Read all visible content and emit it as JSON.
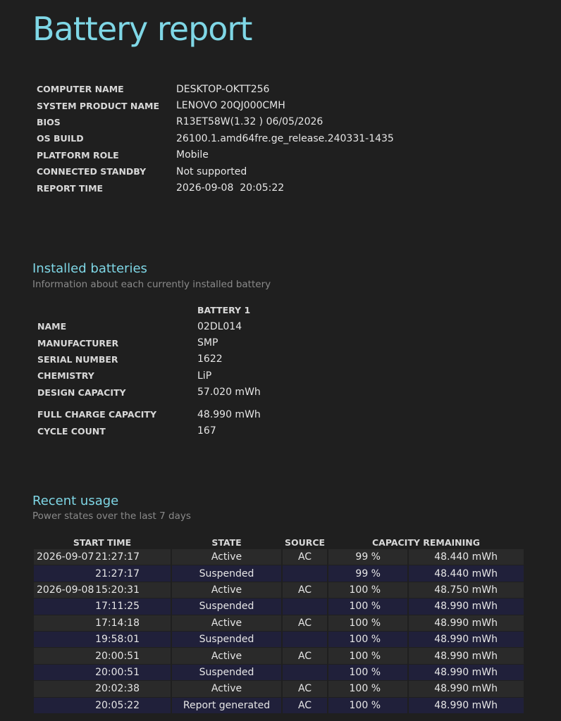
{
  "title": "Battery report",
  "system": [
    {
      "key": "COMPUTER NAME",
      "value": "DESKTOP-OKTT256"
    },
    {
      "key": "SYSTEM PRODUCT NAME",
      "value": "LENOVO 20QJ000CMH"
    },
    {
      "key": "BIOS",
      "value": "R13ET58W(1.32 ) 06/05/2026"
    },
    {
      "key": "OS BUILD",
      "value": "26100.1.amd64fre.ge_release.240331-1435"
    },
    {
      "key": "PLATFORM ROLE",
      "value": "Mobile"
    },
    {
      "key": "CONNECTED STANDBY",
      "value": "Not supported"
    },
    {
      "key": "REPORT TIME",
      "value": "2026-09-08  20:05:22"
    }
  ],
  "installed_batteries": {
    "title": "Installed batteries",
    "subtitle": "Information about each currently installed battery",
    "column_header": "BATTERY 1",
    "rows": [
      {
        "key": "NAME",
        "value": "02DL014"
      },
      {
        "key": "MANUFACTURER",
        "value": "SMP"
      },
      {
        "key": "SERIAL NUMBER",
        "value": "1622"
      },
      {
        "key": "CHEMISTRY",
        "value": "LiP"
      },
      {
        "key": "DESIGN CAPACITY",
        "value": "57.020 mWh"
      },
      {
        "key": "FULL CHARGE CAPACITY",
        "value": "48.990 mWh"
      },
      {
        "key": "CYCLE COUNT",
        "value": "167"
      }
    ]
  },
  "recent_usage": {
    "title": "Recent usage",
    "subtitle": "Power states over the last 7 days",
    "headers": {
      "start_time": "START TIME",
      "state": "STATE",
      "source": "SOURCE",
      "capacity": "CAPACITY REMAINING"
    },
    "rows": [
      {
        "date": "2026-09-07",
        "time": "21:27:17",
        "state": "Active",
        "source": "AC",
        "pct": "99 %",
        "cap": "48.440 mWh"
      },
      {
        "date": "",
        "time": "21:27:17",
        "state": "Suspended",
        "source": "",
        "pct": "99 %",
        "cap": "48.440 mWh"
      },
      {
        "date": "2026-09-08",
        "time": "15:20:31",
        "state": "Active",
        "source": "AC",
        "pct": "100 %",
        "cap": "48.750 mWh"
      },
      {
        "date": "",
        "time": "17:11:25",
        "state": "Suspended",
        "source": "",
        "pct": "100 %",
        "cap": "48.990 mWh"
      },
      {
        "date": "",
        "time": "17:14:18",
        "state": "Active",
        "source": "AC",
        "pct": "100 %",
        "cap": "48.990 mWh"
      },
      {
        "date": "",
        "time": "19:58:01",
        "state": "Suspended",
        "source": "",
        "pct": "100 %",
        "cap": "48.990 mWh"
      },
      {
        "date": "",
        "time": "20:00:51",
        "state": "Active",
        "source": "AC",
        "pct": "100 %",
        "cap": "48.990 mWh"
      },
      {
        "date": "",
        "time": "20:00:51",
        "state": "Suspended",
        "source": "",
        "pct": "100 %",
        "cap": "48.990 mWh"
      },
      {
        "date": "",
        "time": "20:02:38",
        "state": "Active",
        "source": "AC",
        "pct": "100 %",
        "cap": "48.990 mWh"
      },
      {
        "date": "",
        "time": "20:05:22",
        "state": "Report generated",
        "source": "AC",
        "pct": "100 %",
        "cap": "48.990 mWh"
      }
    ]
  },
  "colors": {
    "background": "#1f1f1f",
    "heading": "#7fd7e6",
    "row_odd": "#2a2a2a",
    "row_even": "#20203a"
  }
}
